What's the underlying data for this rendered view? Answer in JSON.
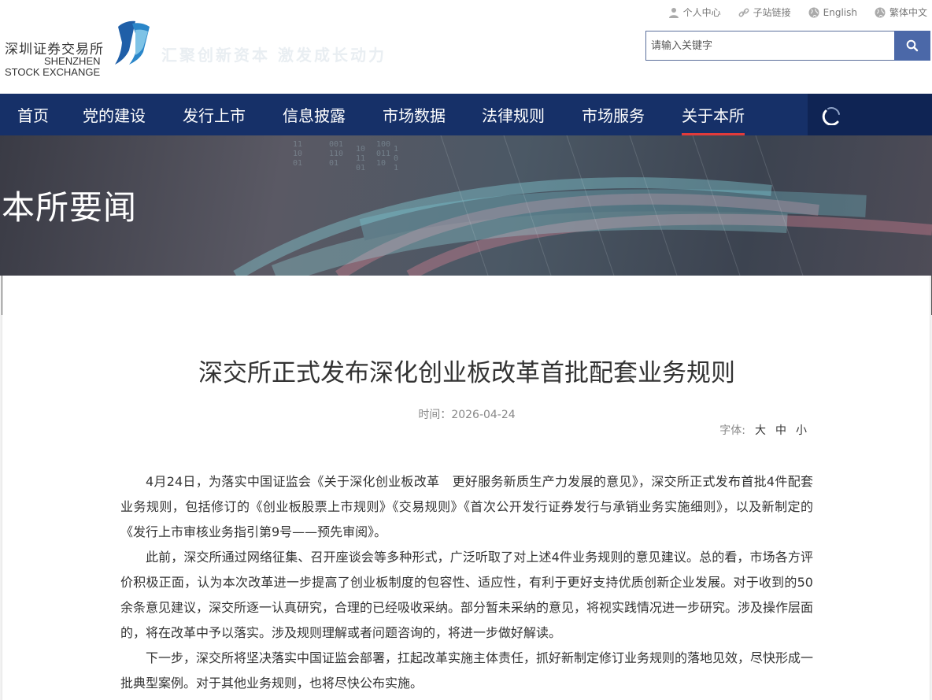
{
  "header": {
    "logo_cn": "深圳证券交易所",
    "logo_en_line1": "SHENZHEN",
    "logo_en_line2": "STOCK EXCHANGE",
    "slogan": "汇聚创新资本  激发成长动力",
    "toplinks": [
      {
        "label": "个人中心",
        "icon": "user-icon"
      },
      {
        "label": "子站链接",
        "icon": "link-icon"
      },
      {
        "label": "English",
        "icon": "globe-icon"
      },
      {
        "label": "繁体中文",
        "icon": "globe-icon"
      }
    ],
    "search": {
      "placeholder": "请输入关键字",
      "icon": "search-icon"
    }
  },
  "nav": {
    "items": [
      {
        "label": "首页"
      },
      {
        "label": "党的建设"
      },
      {
        "label": "发行上市"
      },
      {
        "label": "信息披露"
      },
      {
        "label": "市场数据"
      },
      {
        "label": "法律规则"
      },
      {
        "label": "市场服务"
      },
      {
        "label": "关于本所",
        "active": true
      }
    ],
    "active_color": "#e23b3b",
    "bg_color": "#163068"
  },
  "banner": {
    "title": "本所要闻"
  },
  "article": {
    "title": "深交所正式发布深化创业板改革首批配套业务规则",
    "time_label": "时间：",
    "time": "2026-04-24",
    "fontsize_label": "字体:",
    "fontsize_options": [
      "大",
      "中",
      "小"
    ],
    "paragraphs": [
      "4月24日，为落实中国证监会《关于深化创业板改革　更好服务新质生产力发展的意见》，深交所正式发布首批4件配套业务规则，包括修订的《创业板股票上市规则》《交易规则》《首次公开发行证券发行与承销业务实施细则》，以及新制定的《发行上市审核业务指引第9号——预先审阅》。",
      "此前，深交所通过网络征集、召开座谈会等多种形式，广泛听取了对上述4件业务规则的意见建议。总的看，市场各方评价积极正面，认为本次改革进一步提高了创业板制度的包容性、适应性，有利于更好支持优质创新企业发展。对于收到的50余条意见建议，深交所逐一认真研究，合理的已经吸收采纳。部分暂未采纳的意见，将视实践情况进一步研究。涉及操作层面的，将在改革中予以落实。涉及规则理解或者问题咨询的，将进一步做好解读。",
      "下一步，深交所将坚决落实中国证监会部署，扛起改革实施主体责任，抓好新制定修订业务规则的落地见效，尽快形成一批典型案例。对于其他业务规则，也将尽快公布实施。"
    ]
  }
}
